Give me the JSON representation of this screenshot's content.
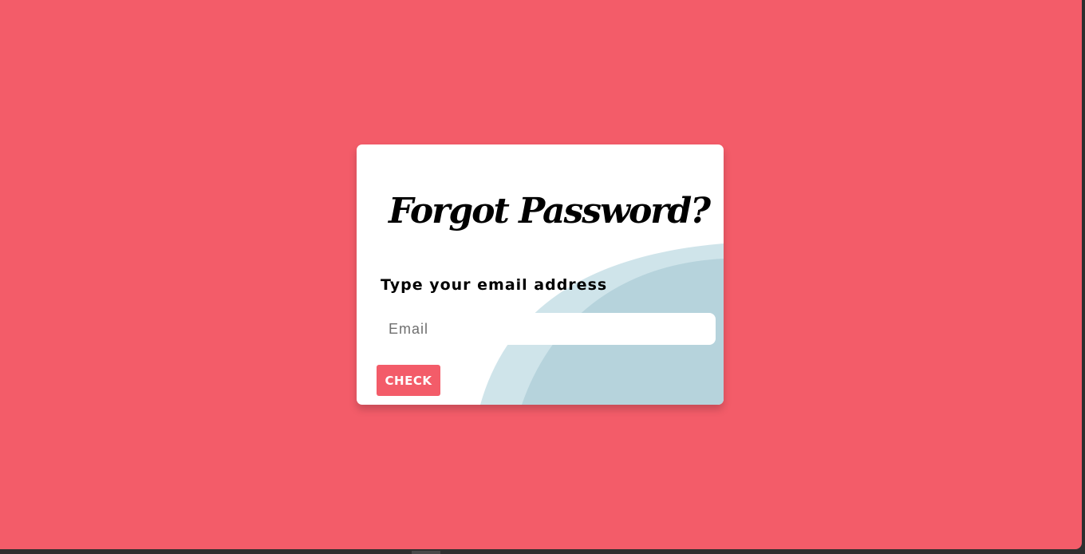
{
  "form": {
    "title": "Forgot Password?",
    "email_label": "Type your email address",
    "email_placeholder": "Email",
    "email_value": "",
    "submit_label": "CHECK"
  },
  "colors": {
    "background": "#f35c69",
    "card": "#ffffff",
    "accent": "#f35c69",
    "wave_light": "#cfe4ea",
    "wave_dark": "#b6d3dc"
  }
}
